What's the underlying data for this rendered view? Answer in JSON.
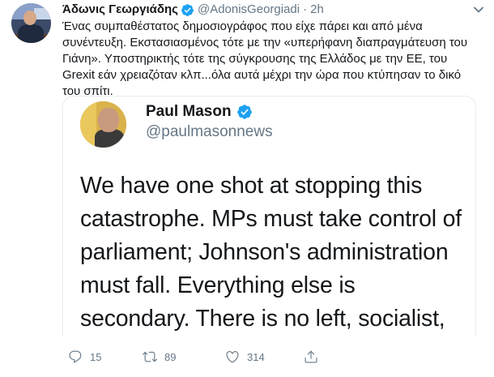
{
  "author": {
    "name": "Άδωνις Γεωργιάδης",
    "handle": "@AdonisGeorgiadi",
    "separator": "·",
    "time": "2h"
  },
  "tweet_text": "Ένας συμπαθέστατος δημοσιογράφος που είχε πάρει και από μένα συνέντευξη. Εκστασιασμένος τότε με την «υπερήφανη διαπραγμάτευση του Γιάνη». Υποστηρικτής τότε της σύγκρουσης της Ελλάδος με την ΕΕ, του Grexit εάν χρειαζόταν κλπ...όλα αυτά μέχρι την ώρα που κτύπησαν το δικό του σπίτι.",
  "quoted": {
    "name": "Paul Mason",
    "handle": "@paulmasonnews",
    "text": "We have one shot at stopping this catastrophe. MPs must take control of parliament; Johnson's administration must fall. Everything else is secondary. There is no left, socialist, green or even"
  },
  "actions": {
    "replies": "15",
    "retweets": "89",
    "likes": "314"
  },
  "icons": {
    "verified": "verified-badge-icon",
    "caret": "chevron-down-icon",
    "reply": "reply-icon",
    "retweet": "retweet-icon",
    "like": "heart-icon",
    "share": "share-icon"
  },
  "colors": {
    "verified": "#1da1f2",
    "secondary_text": "#657786",
    "primary_text": "#14171a"
  }
}
